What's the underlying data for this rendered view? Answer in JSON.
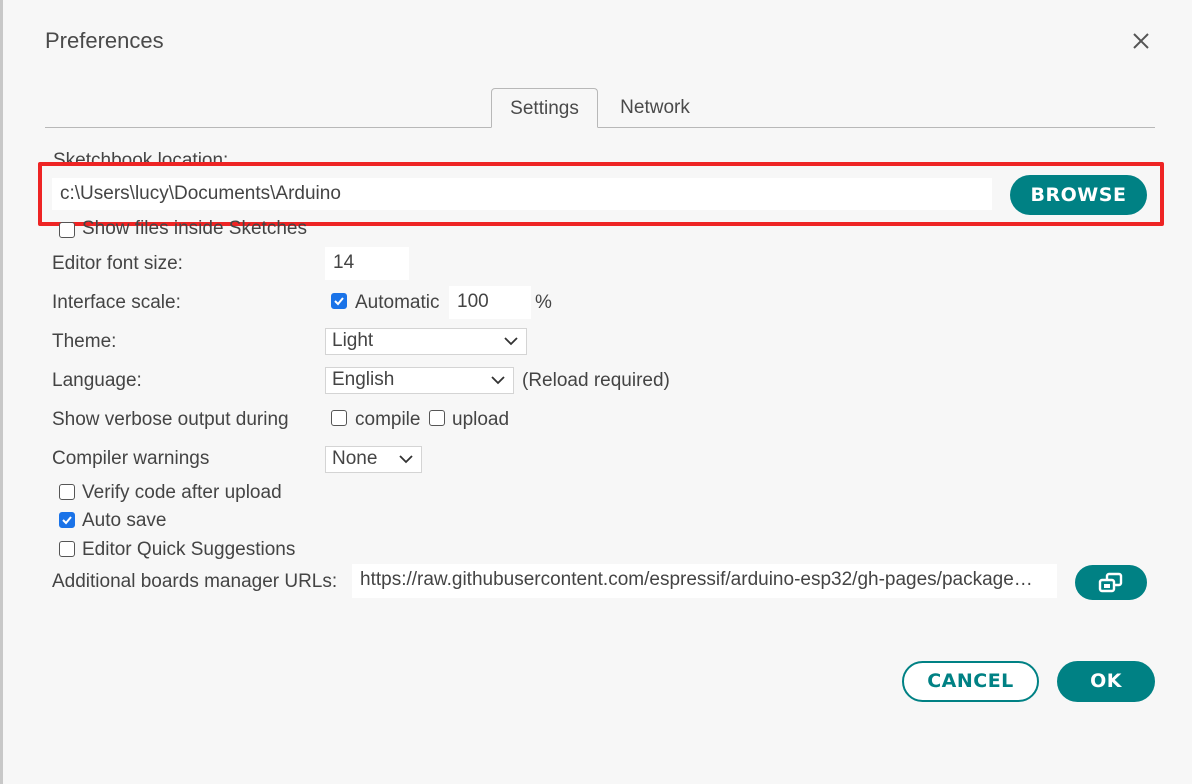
{
  "dialog": {
    "title": "Preferences"
  },
  "tabs": [
    {
      "label": "Settings",
      "active": true
    },
    {
      "label": "Network",
      "active": false
    }
  ],
  "sketchbook": {
    "label": "Sketchbook location:",
    "path": "c:\\Users\\lucy\\Documents\\Arduino",
    "browse_label": "BROWSE"
  },
  "show_files": {
    "label": "Show files inside Sketches",
    "checked": false
  },
  "editor_font_size": {
    "label": "Editor font size:",
    "value": "14"
  },
  "interface_scale": {
    "label": "Interface scale:",
    "automatic_label": "Automatic",
    "automatic_checked": true,
    "value": "100",
    "unit": "%"
  },
  "theme": {
    "label": "Theme:",
    "selected": "Light"
  },
  "language": {
    "label": "Language:",
    "selected": "English",
    "note": "(Reload required)"
  },
  "verbose": {
    "label": "Show verbose output during",
    "compile_label": "compile",
    "compile_checked": false,
    "upload_label": "upload",
    "upload_checked": false
  },
  "compiler_warnings": {
    "label": "Compiler warnings",
    "selected": "None"
  },
  "options": [
    {
      "label": "Verify code after upload",
      "checked": false
    },
    {
      "label": "Auto save",
      "checked": true
    },
    {
      "label": "Editor Quick Suggestions",
      "checked": false
    }
  ],
  "boards_urls": {
    "label": "Additional boards manager URLs:",
    "value": "https://raw.githubusercontent.com/espressif/arduino-esp32/gh-pages/package…"
  },
  "footer": {
    "cancel_label": "CANCEL",
    "ok_label": "OK"
  },
  "colors": {
    "accent": "#008184",
    "checkbox_checked": "#1a73e8",
    "highlight": "#ee2424"
  },
  "icons": {
    "close": "close-icon",
    "chevron": "chevron-down-icon",
    "expand": "open-in-new-window-icon",
    "check": "check-icon"
  }
}
